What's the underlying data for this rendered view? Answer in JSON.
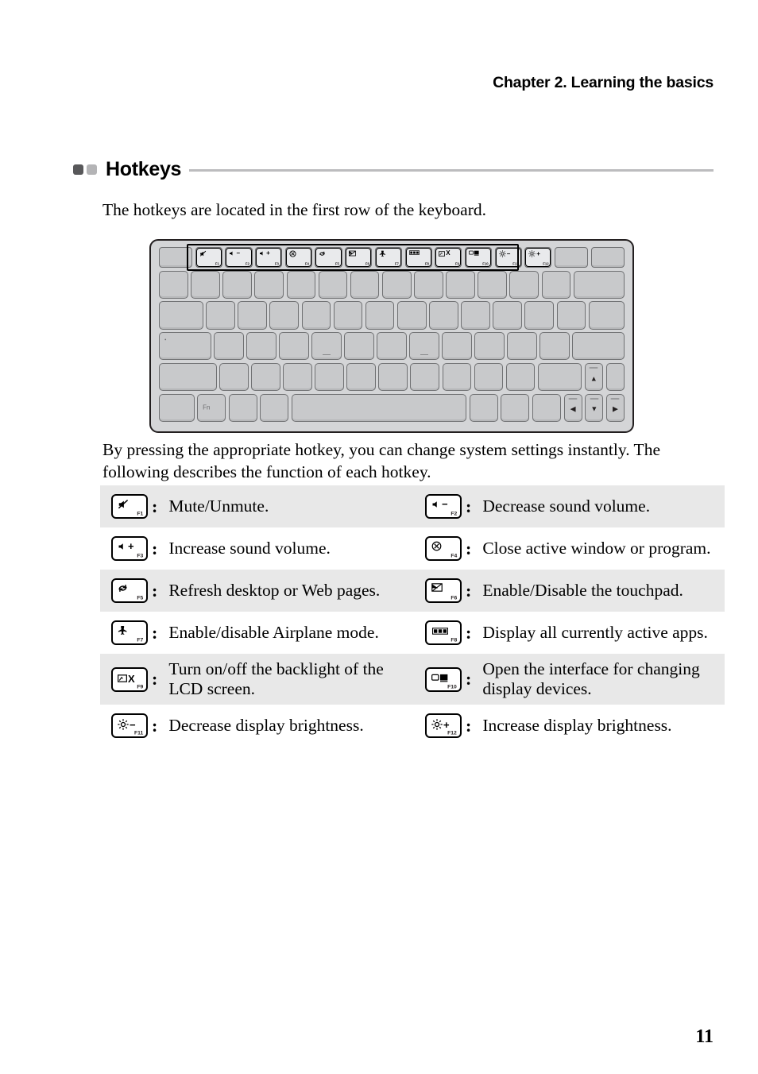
{
  "header": {
    "chapter_title": "Chapter 2. Learning the basics"
  },
  "section": {
    "heading": "Hotkeys",
    "bullet_dark_color": "#58585a",
    "bullet_light_color": "#b4b4b6",
    "rule_color": "#bcbcbe"
  },
  "intro_text": "The hotkeys are located in the first row of the keyboard.",
  "explain_text": "By pressing the appropriate hotkey, you can change system settings instantly. The following describes the function of each hotkey.",
  "keyboard": {
    "caption_fn_key": "Fn",
    "hotkey_row": [
      {
        "fnum": "F1",
        "icon": "mute-icon"
      },
      {
        "fnum": "F2",
        "icon": "volume-down-icon"
      },
      {
        "fnum": "F3",
        "icon": "volume-up-icon"
      },
      {
        "fnum": "F4",
        "icon": "close-window-icon"
      },
      {
        "fnum": "F5",
        "icon": "refresh-icon"
      },
      {
        "fnum": "F6",
        "icon": "touchpad-off-icon"
      },
      {
        "fnum": "F7",
        "icon": "airplane-icon"
      },
      {
        "fnum": "F8",
        "icon": "task-view-icon"
      },
      {
        "fnum": "F9",
        "icon": "backlight-off-icon"
      },
      {
        "fnum": "F10",
        "icon": "display-switch-icon"
      },
      {
        "fnum": "F11",
        "icon": "brightness-down-icon"
      },
      {
        "fnum": "F12",
        "icon": "brightness-up-icon"
      }
    ]
  },
  "hotkey_table": {
    "rows": [
      {
        "shaded": true,
        "left": {
          "fnum": "F1",
          "icon": "mute-icon",
          "colon": ":",
          "description": "Mute/Unmute."
        },
        "right": {
          "fnum": "F2",
          "icon": "volume-down-icon",
          "colon": ":",
          "description": "Decrease sound volume."
        }
      },
      {
        "shaded": false,
        "left": {
          "fnum": "F3",
          "icon": "volume-up-icon",
          "colon": ":",
          "description": "Increase sound volume."
        },
        "right": {
          "fnum": "F4",
          "icon": "close-window-icon",
          "colon": ":",
          "description": "Close active window or program."
        }
      },
      {
        "shaded": true,
        "left": {
          "fnum": "F5",
          "icon": "refresh-icon",
          "colon": ":",
          "description": "Refresh desktop or Web pages."
        },
        "right": {
          "fnum": "F6",
          "icon": "touchpad-off-icon",
          "colon": ":",
          "description": "Enable/Disable the touchpad."
        }
      },
      {
        "shaded": false,
        "left": {
          "fnum": "F7",
          "icon": "airplane-icon",
          "colon": ":",
          "description": "Enable/disable Airplane mode."
        },
        "right": {
          "fnum": "F8",
          "icon": "task-view-icon",
          "colon": ":",
          "description": "Display all currently active apps."
        }
      },
      {
        "shaded": true,
        "left": {
          "fnum": "F9",
          "icon": "backlight-off-icon",
          "colon": ":",
          "description": "Turn on/off the backlight of the LCD screen."
        },
        "right": {
          "fnum": "F10",
          "icon": "display-switch-icon",
          "colon": ":",
          "description": "Open the interface for changing display devices."
        }
      },
      {
        "shaded": false,
        "left": {
          "fnum": "F11",
          "icon": "brightness-down-icon",
          "colon": ":",
          "description": "Decrease display brightness."
        },
        "right": {
          "fnum": "F12",
          "icon": "brightness-up-icon",
          "colon": ":",
          "description": "Increase display brightness."
        }
      }
    ]
  },
  "page_number": "11"
}
